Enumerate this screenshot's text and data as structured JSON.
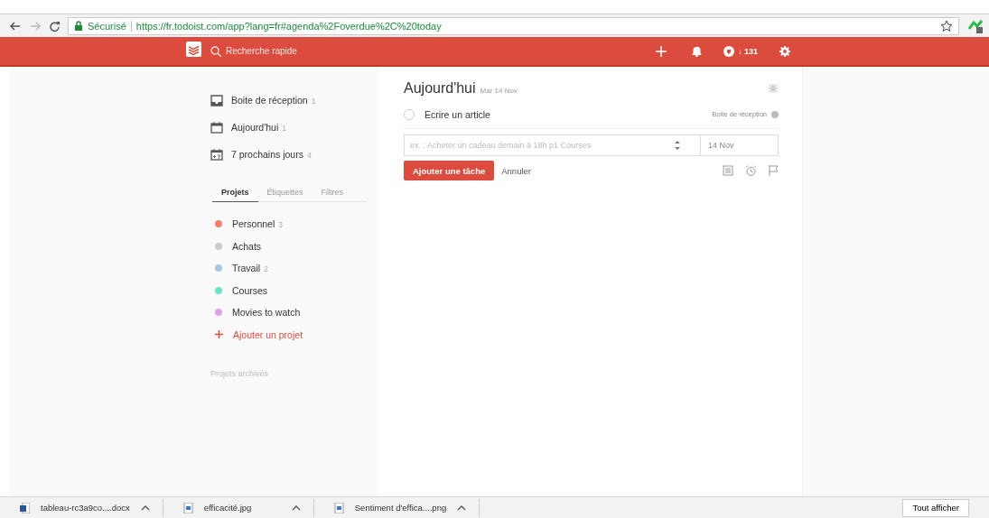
{
  "browser": {
    "secure_label": "Sécurisé",
    "url": "https://fr.todoist.com/app?lang=fr#agenda%2Foverdue%2C%20today"
  },
  "top_bar": {
    "search_placeholder": "Recherche rapide",
    "karma": "↓ 131"
  },
  "sidebar": {
    "filters": [
      {
        "kind": "inbox",
        "label": "Boite de réception",
        "count": "1"
      },
      {
        "kind": "today",
        "label": "Aujourd'hui",
        "count": "1"
      },
      {
        "kind": "week",
        "label": "7 prochains jours",
        "count": "4"
      }
    ],
    "tabs": [
      {
        "label": "Projets",
        "selected": true
      },
      {
        "label": "Étiquettes",
        "selected": false
      },
      {
        "label": "Filtres",
        "selected": false
      }
    ],
    "projects": [
      {
        "name": "Personnel",
        "count": "3",
        "color": "#f4806a"
      },
      {
        "name": "Achats",
        "color": "#cccccc"
      },
      {
        "name": "Travail",
        "count": "2",
        "color": "#a8c8e4"
      },
      {
        "name": "Courses",
        "color": "#6ee0cc"
      },
      {
        "name": "Movies to watch",
        "color": "#e0a0e8"
      }
    ],
    "add_project": "Ajouter un projet",
    "archived": "Projets archivés"
  },
  "main": {
    "title": "Aujourd'hui",
    "date": "Mar 14 Nov",
    "tasks": [
      {
        "text": "Ecrire un article",
        "project": "Boite de réception",
        "checked": false
      }
    ],
    "editor": {
      "placeholder": "ex. : Acheter un cadeau demain à 18h p1 Courses",
      "date": "14 Nov",
      "submit": "Ajouter une tâche",
      "cancel": "Annuler"
    }
  },
  "downloads": {
    "items": [
      {
        "kind": "word",
        "name": "tableau-rc3a9co....docx"
      },
      {
        "kind": "image",
        "name": "efficacité.jpg"
      },
      {
        "kind": "image",
        "name": "Sentiment d'effica....png"
      }
    ],
    "show_all": "Tout afficher"
  }
}
